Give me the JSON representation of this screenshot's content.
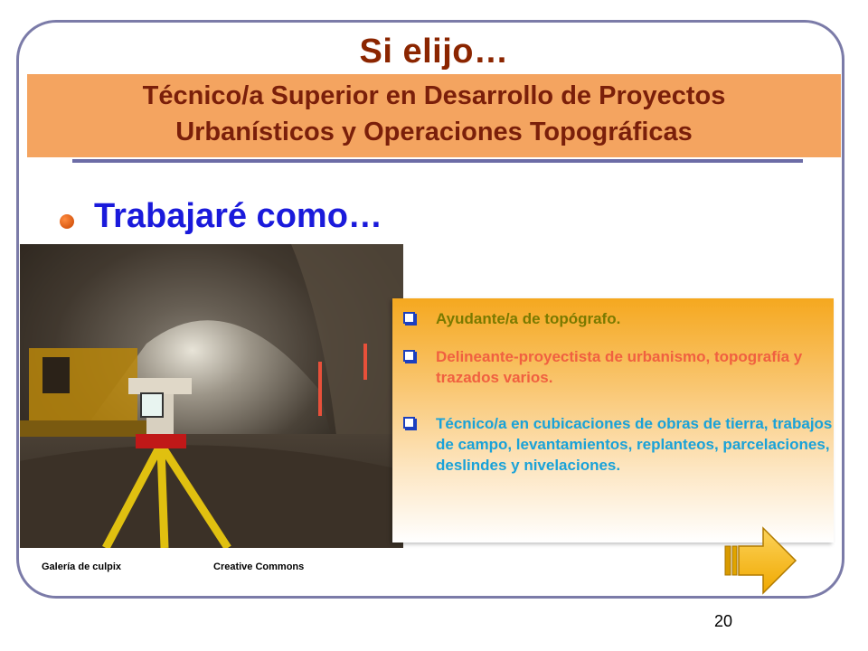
{
  "slide": {
    "title": "Si elijo…",
    "subtitle_line1": "Técnico/a Superior en Desarrollo de Proyectos",
    "subtitle_line2": "Urbanísticos y Operaciones Topográficas",
    "heading": "Trabajaré como…",
    "page_number": "20"
  },
  "jobs": [
    {
      "text": "Ayudante/a de topógrafo.",
      "color": "#7a7a00"
    },
    {
      "text": "Delineante-proyectista de urbanismo, topografía y trazados varios.",
      "color": "#f06040"
    },
    {
      "text": "Técnico/a en cubicaciones de obras de tierra, trabajos de campo, levantamientos, replanteos, parcelaciones, deslindes y nivelaciones.",
      "color": "#1aa2d8"
    }
  ],
  "credits": {
    "gallery": "Galería de culpix",
    "license": "Creative Commons"
  },
  "colors": {
    "title": "#8b2500",
    "band": "#f4a460",
    "heading": "#1a1adb",
    "frame": "#7b7ba8"
  },
  "icons": {
    "bullet": "round-orange-bullet",
    "item_bullet": "checkbox-square-bullet",
    "next": "right-arrow-icon"
  }
}
